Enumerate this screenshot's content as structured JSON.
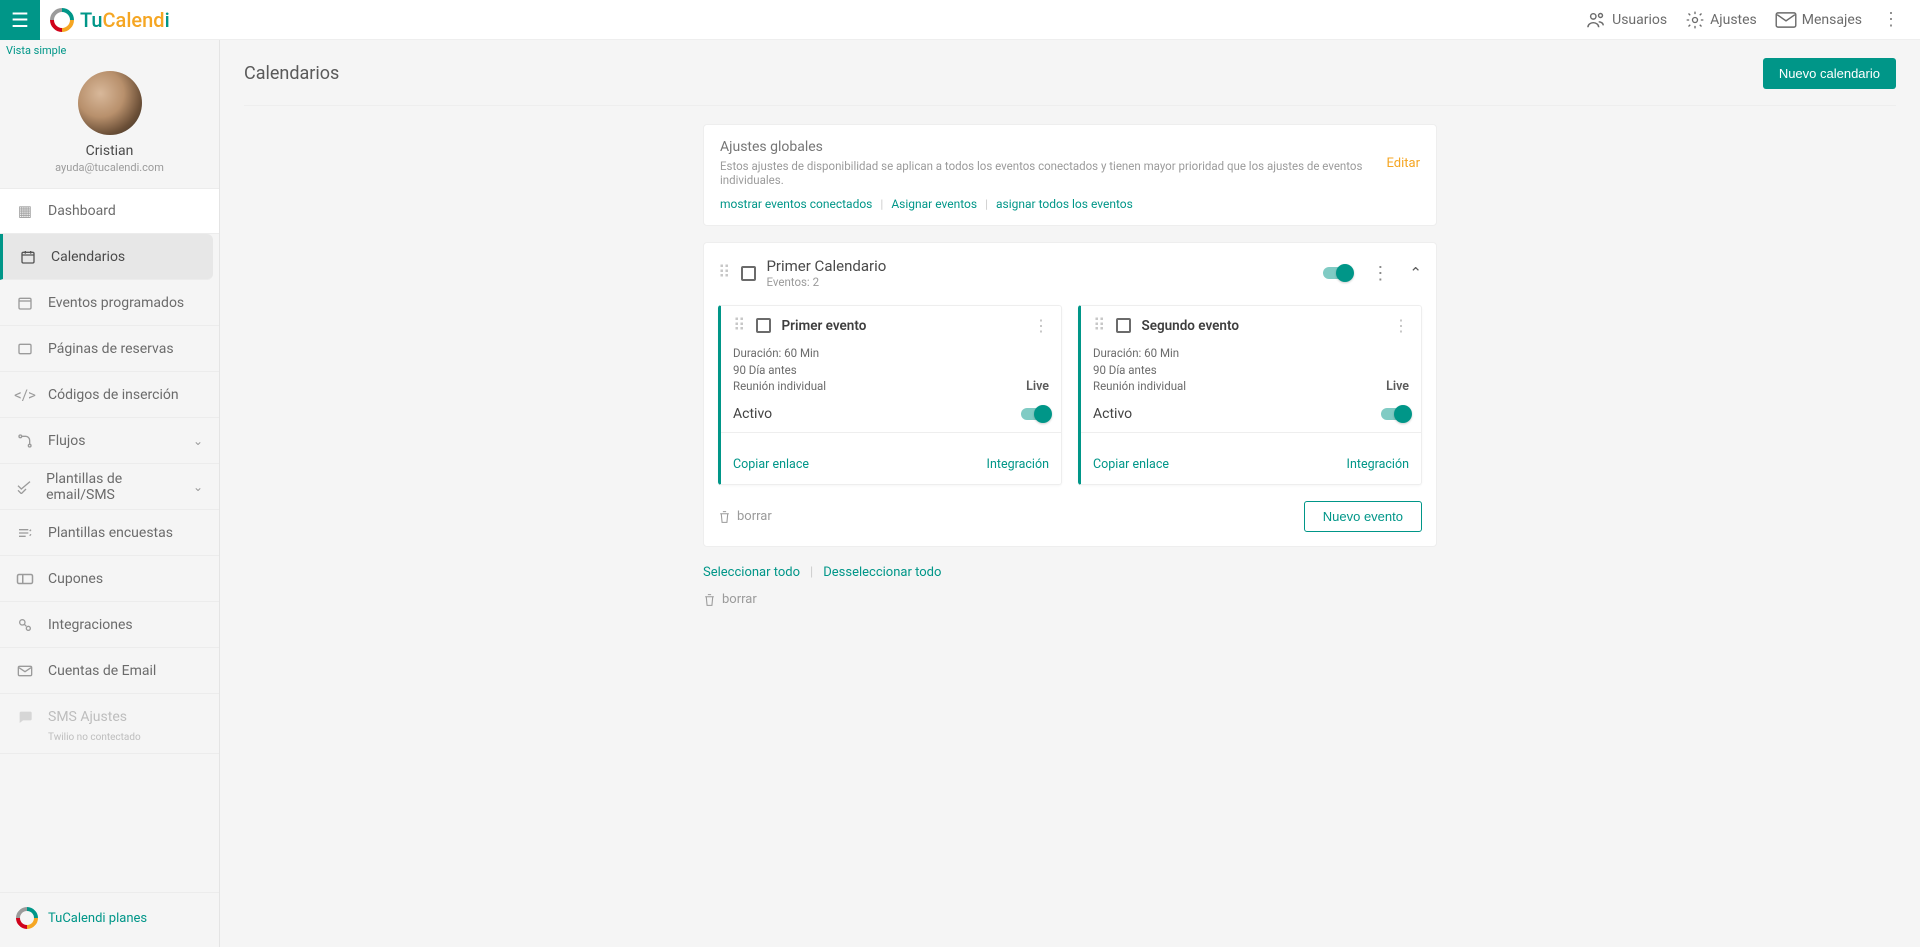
{
  "brand": {
    "part1": "Tu",
    "part2": "Calend",
    "part3": "i"
  },
  "topbar": {
    "users": "Usuarios",
    "settings": "Ajustes",
    "messages": "Mensajes"
  },
  "sidebar": {
    "simple_view": "Vista simple",
    "profile": {
      "name": "Cristian",
      "email": "ayuda@tucalendi.com"
    },
    "items": [
      {
        "label": "Dashboard"
      },
      {
        "label": "Calendarios"
      },
      {
        "label": "Eventos programados"
      },
      {
        "label": "Páginas de reservas"
      },
      {
        "label": "Códigos de inserción"
      },
      {
        "label": "Flujos"
      },
      {
        "label": "Plantillas de email/SMS"
      },
      {
        "label": "Plantillas encuestas"
      },
      {
        "label": "Cupones"
      },
      {
        "label": "Integraciones"
      },
      {
        "label": "Cuentas de Email"
      },
      {
        "label": "SMS Ajustes",
        "sub": "Twilio no contectado"
      }
    ],
    "footer": "TuCalendi planes"
  },
  "page": {
    "title": "Calendarios",
    "new_calendar": "Nuevo calendario"
  },
  "global": {
    "title": "Ajustes globales",
    "desc": "Estos ajustes de disponibilidad se aplican a todos los eventos conectados y tienen mayor prioridad que los ajustes de eventos individuales.",
    "edit": "Editar",
    "link_show": "mostrar eventos conectados",
    "link_assign": "Asignar eventos",
    "link_assign_all": "asignar todos los eventos"
  },
  "calendar": {
    "title": "Primer Calendario",
    "subtitle": "Eventos: 2",
    "delete": "borrar",
    "new_event": "Nuevo evento",
    "events": [
      {
        "title": "Primer evento",
        "duration": "Duración: 60 Min",
        "days": "90 Día antes",
        "type": "Reunión individual",
        "live": "Live",
        "active_label": "Activo",
        "copy_link": "Copiar enlace",
        "integration": "Integración"
      },
      {
        "title": "Segundo evento",
        "duration": "Duración: 60 Min",
        "days": "90 Día antes",
        "type": "Reunión individual",
        "live": "Live",
        "active_label": "Activo",
        "copy_link": "Copiar enlace",
        "integration": "Integración"
      }
    ]
  },
  "selection": {
    "select_all": "Seleccionar todo",
    "deselect_all": "Desseleccionar todo",
    "delete": "borrar"
  }
}
